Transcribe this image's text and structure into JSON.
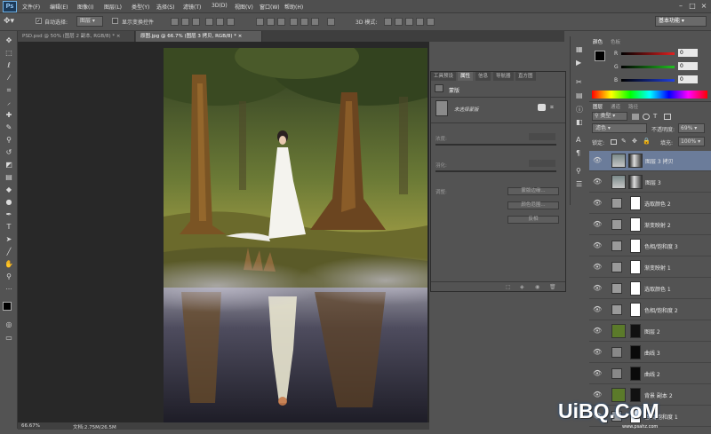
{
  "app": {
    "logo": "Ps"
  },
  "menus": [
    "文件(F)",
    "编辑(E)",
    "图像(I)",
    "图层(L)",
    "类型(Y)",
    "选择(S)",
    "滤镜(T)",
    "3D(D)",
    "视图(V)",
    "窗口(W)",
    "帮助(H)"
  ],
  "options": {
    "auto_select_label": "自动选择:",
    "auto_select_value": "图层",
    "show_transform_label": "显示变换控件",
    "mode_3d_label": "3D 模式:",
    "workspace": "基本功能"
  },
  "tabs": [
    {
      "label": "PSD.psd @ 50% (图层 2 副本, RGB/8) *",
      "close": "×"
    },
    {
      "label": "原图.jpg @ 66.7% (图层 3 拷贝, RGB/8) *",
      "close": "×"
    }
  ],
  "status": {
    "zoom": "66.67%",
    "doc": "文档:2.75M/26.5M"
  },
  "properties": {
    "tabs": [
      "工具预设",
      "属性",
      "信息",
      "导航器",
      "直方图"
    ],
    "title": "蒙版",
    "no_selection": "未选择蒙版",
    "density_label": "浓度:",
    "feather_label": "羽化:",
    "adjust_label": "调整:",
    "btn_edge": "蒙版边缘...",
    "btn_color_range": "颜色范围...",
    "btn_invert": "反相"
  },
  "color_panel": {
    "tabs": [
      "颜色",
      "色板"
    ],
    "r_label": "R",
    "g_label": "G",
    "b_label": "B",
    "r_value": "0",
    "g_value": "0",
    "b_value": "0",
    "fg": "#000000",
    "bg": "#ffffff"
  },
  "layers_panel": {
    "tabs": [
      "图层",
      "通道",
      "路径"
    ],
    "kind": "类型",
    "blend_mode": "滤色",
    "opacity_label": "不透明度:",
    "opacity_value": "69%",
    "lock_label": "锁定:",
    "fill_label": "填充:",
    "fill_value": "100%",
    "layers": [
      {
        "name": "图层 3 拷贝",
        "type": "photo",
        "selected": true
      },
      {
        "name": "图层 3",
        "type": "photo",
        "selected": false
      },
      {
        "name": "选取颜色 2",
        "type": "adj",
        "selected": false
      },
      {
        "name": "渐变映射 2",
        "type": "adj",
        "selected": false
      },
      {
        "name": "色相/饱和度 3",
        "type": "adj",
        "selected": false
      },
      {
        "name": "渐变映射 1",
        "type": "adj",
        "selected": false
      },
      {
        "name": "选取颜色 1",
        "type": "adj",
        "selected": false
      },
      {
        "name": "色相/饱和度 2",
        "type": "adj",
        "selected": false
      },
      {
        "name": "图层 2",
        "type": "green",
        "selected": false
      },
      {
        "name": "曲线 3",
        "type": "curve",
        "selected": false
      },
      {
        "name": "曲线 2",
        "type": "curve",
        "selected": false
      },
      {
        "name": "背景 副本 2",
        "type": "green",
        "selected": false
      },
      {
        "name": "色相/饱和度 1",
        "type": "adj",
        "selected": false
      }
    ]
  },
  "watermark": {
    "text": "UiBQ.CoM",
    "subtext": "www.psahz.com"
  }
}
